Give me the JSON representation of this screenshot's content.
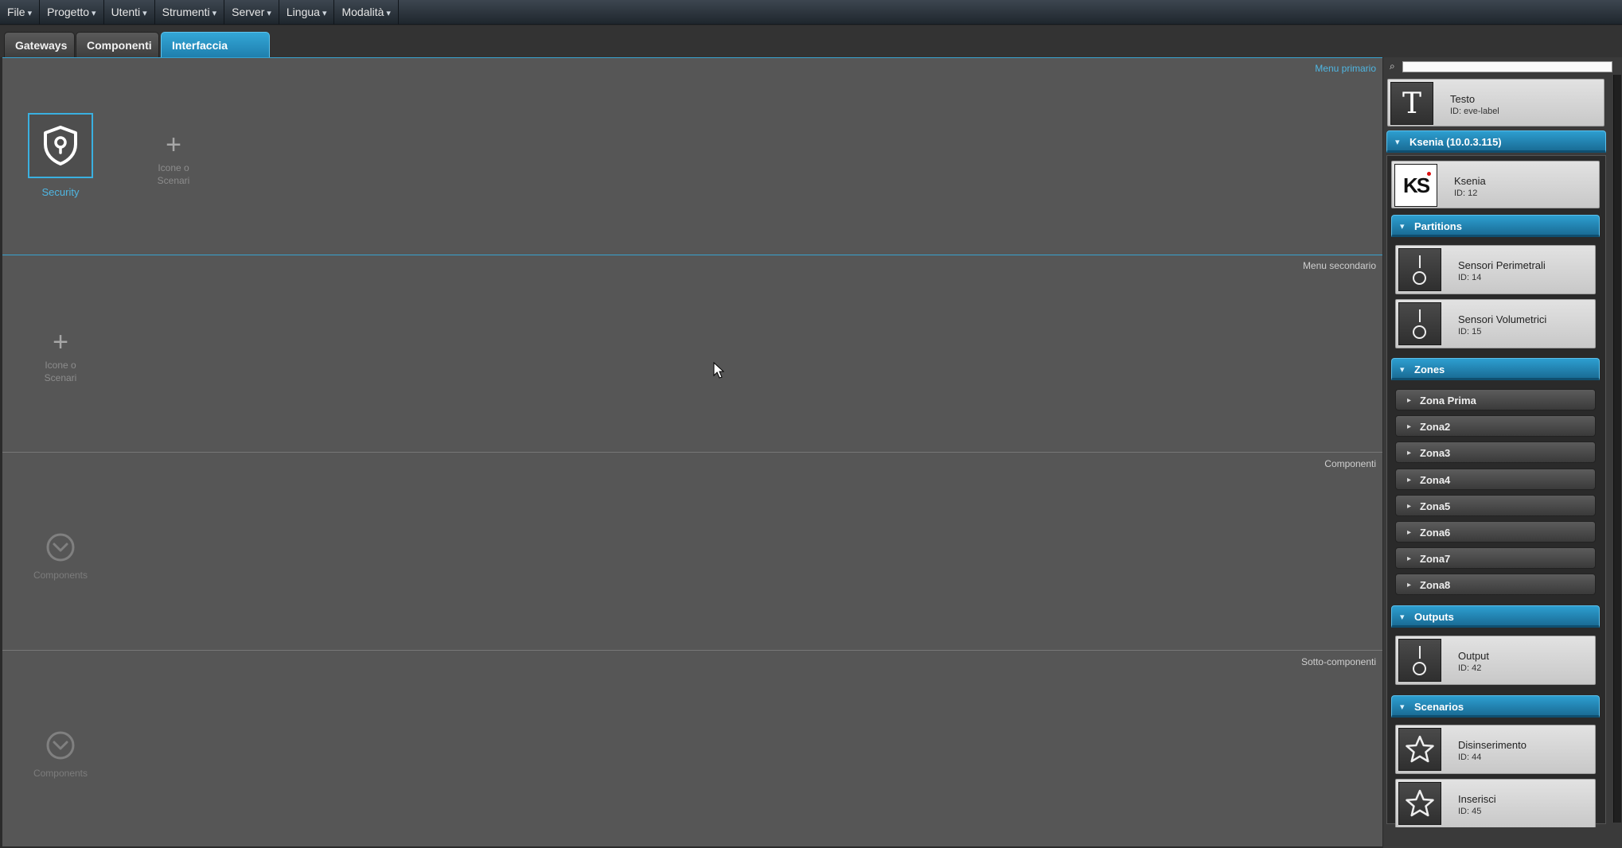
{
  "menubar": {
    "items": [
      "File",
      "Progetto",
      "Utenti",
      "Strumenti",
      "Server",
      "Lingua",
      "Modalità"
    ]
  },
  "tabs": [
    {
      "label": "Gateways",
      "active": false
    },
    {
      "label": "Componenti",
      "active": false
    },
    {
      "label": "Interfaccia Utente",
      "active": true
    }
  ],
  "main": {
    "primary": {
      "label": "Menu primario",
      "tile_label": "Security",
      "add_label_1": "Icone o",
      "add_label_2": "Scenari"
    },
    "secondary": {
      "label": "Menu secondario",
      "add_label_1": "Icone o",
      "add_label_2": "Scenari"
    },
    "components": {
      "label": "Componenti",
      "tile_label": "Components"
    },
    "subcomponents": {
      "label": "Sotto-componenti",
      "tile_label": "Components"
    }
  },
  "rightpanel": {
    "search": {
      "placeholder": ""
    },
    "text_item": {
      "title": "Testo",
      "id": "ID: eve-label",
      "icon": "T"
    },
    "gateway": {
      "header": "Ksenia (10.0.3.115)",
      "card": {
        "title": "Ksenia",
        "id": "ID: 12",
        "logo": "KS"
      }
    },
    "partitions": {
      "header": "Partitions",
      "items": [
        {
          "title": "Sensori Perimetrali",
          "id": "ID: 14"
        },
        {
          "title": "Sensori Volumetrici",
          "id": "ID: 15"
        }
      ]
    },
    "zones": {
      "header": "Zones",
      "items": [
        "Zona Prima",
        "Zona2",
        "Zona3",
        "Zona4",
        "Zona5",
        "Zona6",
        "Zona7",
        "Zona8"
      ]
    },
    "outputs": {
      "header": "Outputs",
      "items": [
        {
          "title": "Output",
          "id": "ID: 42"
        }
      ]
    },
    "scenarios": {
      "header": "Scenarios",
      "items": [
        {
          "title": "Disinserimento",
          "id": "ID: 44"
        },
        {
          "title": "Inserisci",
          "id": "ID: 45"
        }
      ]
    }
  },
  "colors": {
    "accent": "#2d9ed0",
    "panel": "#565656",
    "card": "#d6d6d6"
  }
}
